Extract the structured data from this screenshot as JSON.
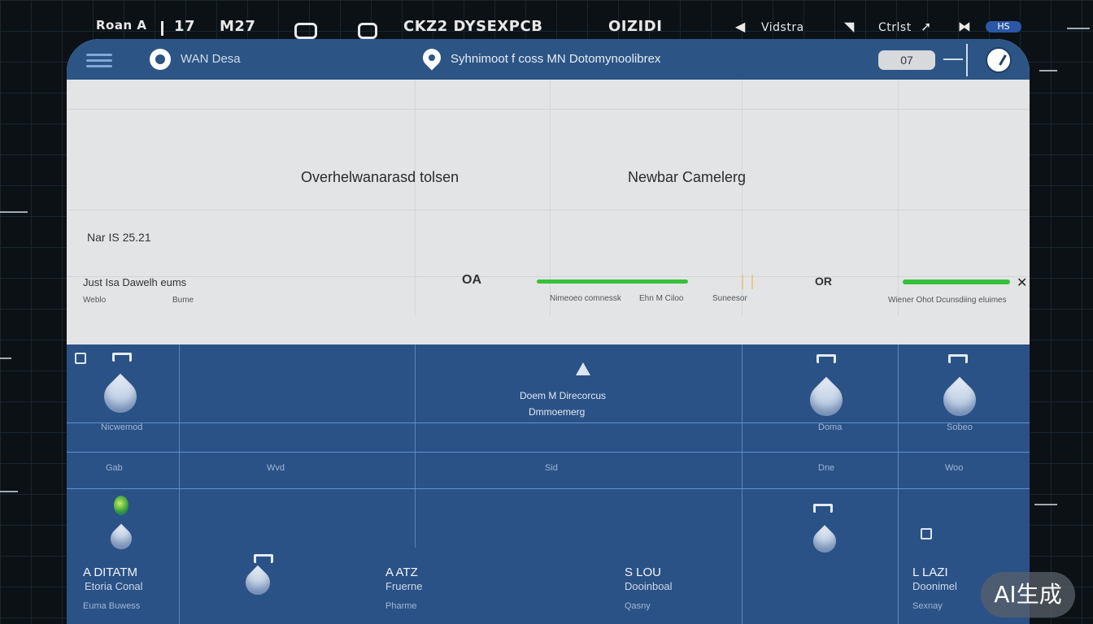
{
  "statusbar": {
    "left": "Roan A",
    "time": "17",
    "m_label": "M27",
    "center": "CKZ2 DYSEXPCB",
    "mid": "OIZIDI",
    "region": "Vidstra",
    "user": "Ctrlst",
    "badge": "HS"
  },
  "header": {
    "app_title": "WAN Desa",
    "center_title": "Syhnimoot f coss  MN  Dotomynoolibrex",
    "pill_value": "07"
  },
  "overview": {
    "heading_left": "Overhelwanarasd  tolsen",
    "heading_right": "Newbar Camelerg",
    "date": "Nar IS 25.21",
    "row_label": "Just Isa Dawelh eums",
    "col_a": "Weblo",
    "col_b": "Bume",
    "value_1": "OA",
    "caption_1": "Nimeoeo comnessk",
    "caption_2": "Ehn M Ciloo",
    "caption_3": "Suneesor",
    "value_2": "OR",
    "caption_4": "Wiener Ohot Dcunsdiing eluimes"
  },
  "progress": {
    "bar_1": 1.0,
    "bar_2": 1.0,
    "color": "#37c13b"
  },
  "grid": {
    "cell_label_a": "Nicwemod",
    "center_line1": "Doem M Direcorcus",
    "center_line2": "Dmmoemerg",
    "cell_label_b": "Doma",
    "cell_label_c": "Sobeo",
    "row2": [
      "Gab",
      "Wvd",
      "Sid",
      "Dne",
      "Woo"
    ],
    "tiles": [
      {
        "title": "A DITATM",
        "subtitle": "Etoria Conal",
        "note": "Euma Buwess"
      },
      {
        "title": "A ATZ",
        "subtitle": "Fruerne",
        "note": "Pharme"
      },
      {
        "title": "S LOU",
        "subtitle": "Dooinboal",
        "note": "Qasny"
      },
      {
        "title": "L LAZI",
        "subtitle": "Doonimel",
        "note": "Sexnay"
      }
    ]
  },
  "badge_text": "AI生成"
}
